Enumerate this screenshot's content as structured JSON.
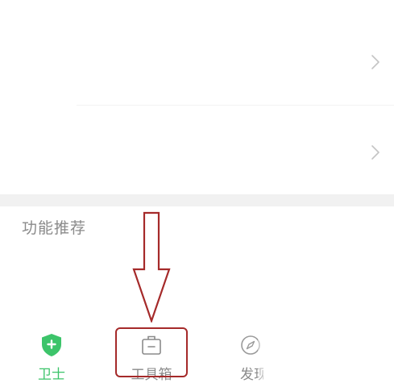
{
  "section": {
    "title": "功能推荐"
  },
  "tabbar": {
    "tabs": [
      {
        "label": "卫士",
        "icon": "shield-plus-icon",
        "active": true
      },
      {
        "label": "工具箱",
        "icon": "toolbox-icon",
        "active": false
      },
      {
        "label": "发现",
        "icon": "compass-icon",
        "active": false
      }
    ],
    "discover_visible_label": "发现"
  },
  "colors": {
    "active": "#3cc46a",
    "inactive": "#8a8a8a",
    "annotation": "#a52a2a",
    "divider": "#f1f1f1"
  }
}
